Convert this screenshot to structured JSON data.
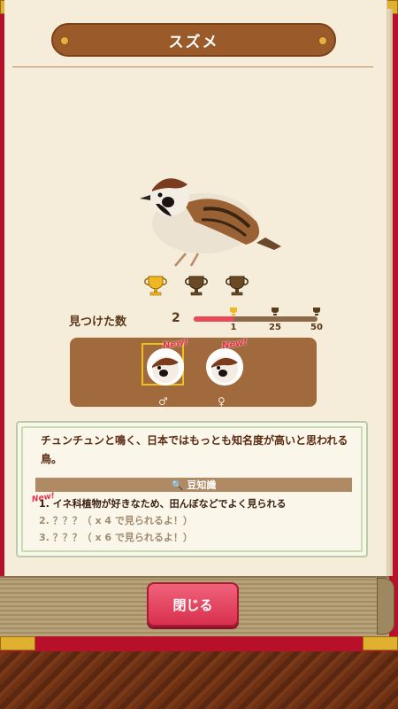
{
  "header": {
    "title": "スズメ"
  },
  "stats": {
    "found_label": "見つけた数",
    "found_count": "2",
    "progress_fraction": 0.33,
    "thresholds": [
      "1",
      "25",
      "50"
    ]
  },
  "trophies": [
    {
      "icon": "trophy-gold-icon",
      "earned": true
    },
    {
      "icon": "trophy-bronze-icon",
      "earned": false
    },
    {
      "icon": "trophy-bronze-icon",
      "earned": false
    }
  ],
  "gender": {
    "male_symbol": "♂",
    "female_symbol": "♀",
    "male_new": "New!",
    "female_new": "New!"
  },
  "description": {
    "text": "チュンチュンと鳴く、日本ではもっとも知名度が高いと思われる鳥。",
    "trivia_title": "豆知識",
    "new_badge": "New!",
    "items": [
      "1. イネ科植物が好きなため、田んぼなどでよく見られる",
      "2. ？？？（ x 4 で見られるよ！）",
      "3. ？？？（ x 6 で見られるよ！）"
    ]
  },
  "footer": {
    "close_label": "閉じる"
  },
  "colors": {
    "frame": "#b8102a",
    "panel": "#a06a3c",
    "accent": "#e84a5a"
  }
}
